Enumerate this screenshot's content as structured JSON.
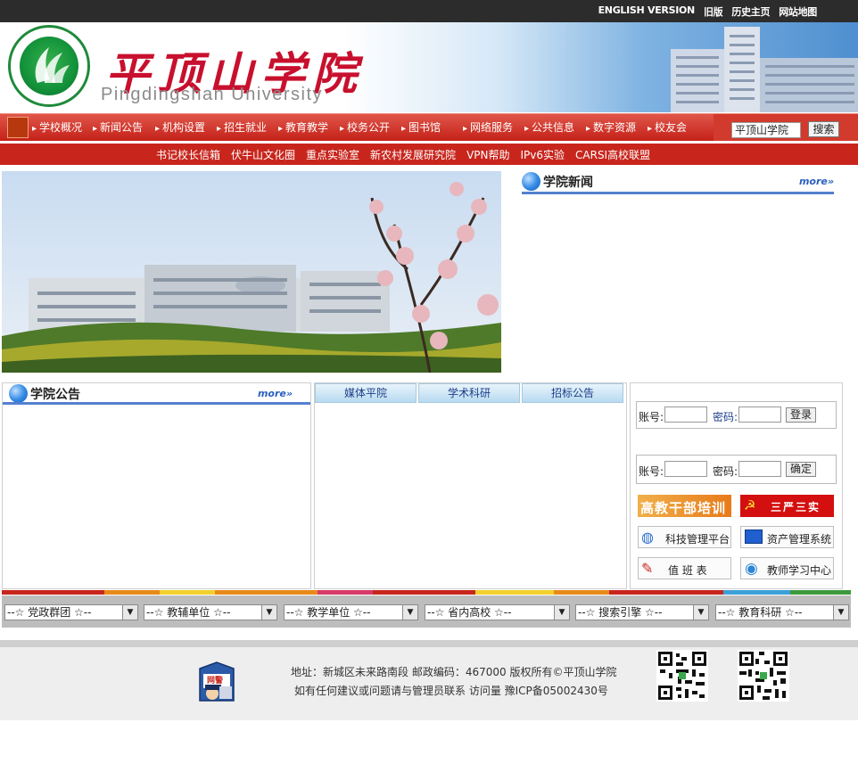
{
  "topbar": {
    "links": [
      "ENGLISH VERSION",
      "旧版",
      "历史主页",
      "网站地图"
    ]
  },
  "banner": {
    "title_cn": "平顶山学院",
    "title_en": "Pingdingshan University",
    "seal_text_top": "平顶山学院",
    "seal_text_bottom": "PINGDINGSHAN UNIVERSITY"
  },
  "nav": {
    "items": [
      "学校概况",
      "新闻公告",
      "机构设置",
      "招生就业",
      "教育教学",
      "校务公开",
      "图书馆",
      "网络服务",
      "公共信息",
      "数字资源",
      "校友会"
    ],
    "search_value": "平顶山学院",
    "search_button": "搜索"
  },
  "subnav": {
    "items": [
      "书记校长信箱",
      "伏牛山文化圈",
      "重点实验室",
      "新农村发展研究院",
      "VPN帮助",
      "IPv6实验",
      "CARSI高校联盟"
    ]
  },
  "news": {
    "title": "学院新闻",
    "more": "more»"
  },
  "notice": {
    "title": "学院公告",
    "more": "more»"
  },
  "tabs": [
    "媒体平院",
    "学术科研",
    "招标公告"
  ],
  "login1": {
    "account_label": "账号:",
    "password_label": "密码:",
    "button": "登录"
  },
  "login2": {
    "account_label": "账号:",
    "password_label": "密码:",
    "button": "确定"
  },
  "promos": {
    "training": "高教干部培训",
    "sanyan": "三严三实",
    "tech": "科技管理平台",
    "assets": "资产管理系统",
    "duty": "值 班 表",
    "teacher": "教师学习中心"
  },
  "selects": [
    "--☆ 党政群团 ☆--",
    "--☆ 教辅单位 ☆--",
    "--☆ 教学单位 ☆--",
    "--☆ 省内高校 ☆--",
    "--☆ 搜索引擎 ☆--",
    "--☆ 教育科研 ☆--"
  ],
  "footer": {
    "line1": "地址：新城区未来路南段 邮政编码：467000 版权所有©平顶山学院",
    "line2": "如有任何建议或问题请与管理员联系 访问量    豫ICP备05002430号",
    "badge_text": "网警"
  },
  "colors": {
    "nav_red": "#c42118",
    "link_blue": "#2a5fbf",
    "tab_text": "#1c3c8a"
  }
}
